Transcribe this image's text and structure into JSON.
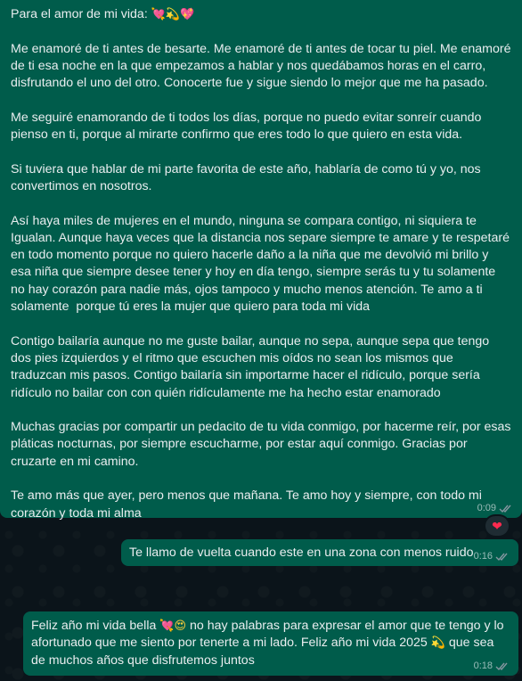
{
  "chat": {
    "messages": [
      {
        "heading": "Para el amor de mi vida:",
        "heading_emojis": [
          "💘",
          "💫",
          "💖"
        ],
        "paragraphs": [
          "Me enamoré de ti antes de besarte. Me enamoré de ti antes de tocar tu piel. Me enamoré de ti esa noche en la que empezamos a hablar y nos quedábamos horas en el carro, disfrutando el uno del otro. Conocerte fue y sigue siendo lo mejor que me ha pasado.",
          "Me seguiré enamorando de ti todos los días, porque no puedo evitar sonreír cuando pienso en ti, porque al mirarte confirmo que eres todo lo que quiero en esta vida.",
          "Si tuviera que hablar de mi parte favorita de este año, hablaría de como tú y yo, nos convertimos en nosotros.",
          "Así haya miles de mujeres en el mundo, ninguna se compara contigo, ni siquiera te Igualan. Aunque haya veces que la distancia nos separe siempre te amare y te respetaré en todo momento porque no quiero hacerle daño a la niña que me devolvió mi brillo y esa niña que siempre desee tener y hoy en día tengo, siempre serás tu y tu solamente no hay corazón para nadie más, ojos tampoco y mucho menos atención. Te amo a ti solamente  porque tú eres la mujer que quiero para toda mi vida",
          "Contigo bailaría aunque no me guste bailar, aunque no sepa, aunque sepa que tengo dos pies izquierdos y el ritmo que escuchen mis oídos no sean los mismos que traduzcan mis pasos. Contigo bailaría sin importarme hacer el ridículo, porque sería ridículo no bailar con con quién ridículamente me ha hecho estar enamorado",
          "Muchas gracias por compartir un pedacito de tu vida conmigo, por hacerme reír, por esas pláticas nocturnas, por siempre escucharme, por estar aquí conmigo. Gracias por cruzarte en mi camino.",
          "Te amo más que ayer, pero menos que mañana. Te amo hoy y siempre, con todo mi corazón y toda mi alma"
        ],
        "time": "0:09",
        "reaction": "❤"
      },
      {
        "text": "Te llamo de vuelta cuando este en una zona con menos ruido",
        "time": "0:16"
      },
      {
        "text_1": "Feliz año mi vida bella",
        "emojis_1": [
          "💘",
          "😍"
        ],
        "text_2": "no hay palabras para expresar el amor que te tengo y lo afortunado que me siento por tenerte a mi lado. Feliz año mi vida 2025",
        "emojis_2": [
          "💫"
        ],
        "text_3": "que sea de muchos años que disfrutemos juntos",
        "time": "0:18"
      }
    ]
  },
  "colors": {
    "bubble_outgoing": "#005c4b",
    "background": "#0b141a",
    "text": "#e9edef",
    "read_ticks": "#8696a0"
  },
  "icons": {
    "read_receipt": "double-check-icon",
    "reaction": "red-heart-icon"
  }
}
